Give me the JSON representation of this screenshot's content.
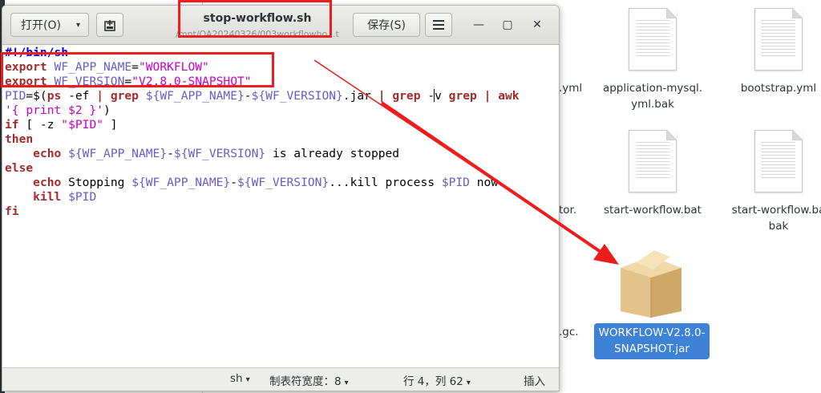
{
  "window": {
    "title": "stop-workflow.sh",
    "path": "/mnt/OA20240326/003workflowbo...t",
    "open_label": "打开(O)",
    "save_label": "保存(S)",
    "caret": "▾",
    "new_icon": "new-document-icon",
    "menu_icon": "hamburger-menu-icon",
    "min_glyph": "—",
    "max_glyph": "▢",
    "close_glyph": "✕"
  },
  "code": {
    "l1": "#!/bin/sh",
    "l2_kw": "export",
    "l2_var": "WF_APP_NAME",
    "l2_eq": "=",
    "l2_str": "\"WORKFLOW\"",
    "l3_kw": "export",
    "l3_var": "WF_VERSION",
    "l3_eq": "=",
    "l3_str": "\"V2.8.0-SNAPSHOT\"",
    "l4_a": "PID",
    "l4_b": "=$(",
    "l4_c": "ps",
    "l4_d": " -ef ",
    "l4_e": "|",
    "l4_f": " ",
    "l4_g": "grep",
    "l4_h": " ",
    "l4_i": "${WF_APP_NAME}",
    "l4_j": "-",
    "l4_k": "${WF_VERSION}",
    "l4_l": ".jar ",
    "l4_m": "|",
    "l4_n": " ",
    "l4_o": "grep",
    "l4_p": " -",
    "l4_q": "v ",
    "l4_r": "grep",
    "l4_s": " ",
    "l4_t": "|",
    "l4_u": " ",
    "l4_v": "awk",
    "l5_str": "'{ print $2 }'",
    "l5_close": ")",
    "l6_kw": "if",
    "l6_a": " [ -z ",
    "l6_str": "\"$PID\"",
    "l6_b": " ]",
    "l7_kw": "then",
    "l8_kw": "echo",
    "l8_a": " ",
    "l8_v1": "${WF_APP_NAME}",
    "l8_b": "-",
    "l8_v2": "${WF_VERSION}",
    "l8_c": " is already stopped",
    "l9_kw": "else",
    "l10_kw": "echo",
    "l10_a": " Stopping ",
    "l10_v1": "${WF_APP_NAME}",
    "l10_b": "-",
    "l10_v2": "${WF_VERSION}",
    "l10_c": "...kill process ",
    "l10_v3": "$PID",
    "l10_d": " now.",
    "l11_kw": "kill",
    "l11_a": " ",
    "l11_v": "$PID",
    "l12_kw": "fi"
  },
  "statusbar": {
    "language": "sh",
    "tab_width": "制表符宽度：8",
    "position": "行 4，列 62",
    "mode": "插入"
  },
  "files": {
    "partial_yml": ".yml",
    "app_mysql": "application-mysql.\nyml.bak",
    "bootstrap": "bootstrap.yml",
    "partial_tor": "tor.",
    "start_bat": "start-workflow.bat",
    "start_bat_bak": "start-workflow.ba\nbak",
    "partial_gc": ".gc.",
    "jar": "WORKFLOW-V2.8.0-\nSNAPSHOT.jar"
  },
  "colors": {
    "annotation_red": "#ee1c1c",
    "selection_blue": "#3d82d6"
  }
}
